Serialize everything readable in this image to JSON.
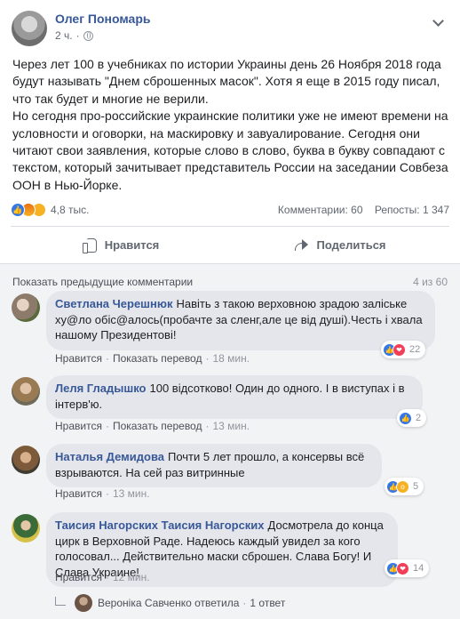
{
  "post": {
    "author": "Олег Пономарь",
    "time": "2 ч.",
    "paragraphs": [
      "Через лет 100 в учебниках по истории Украины день 26 Ноября 2018 года будут называть \"Днем сброшенных масок\". Хотя я еще в 2015 году писал, что так будет и многие не верили.",
      "Но сегодня про-российские украинские политики уже не имеют времени на условности и оговорки, на маскировку и завуалирование. Сегодня они читают свои заявления, которые слово в слово, буква в букву совпадают с текстом, который зачитывает представитель России на заседании Совбеза ООН в Нью-Йорке."
    ],
    "reactions_count": "4,8 тыс.",
    "comments_count": "Комментарии: 60",
    "shares_count": "Репосты: 1 347",
    "like_label": "Нравится",
    "share_label": "Поделиться"
  },
  "comments_header": {
    "show_previous": "Показать предыдущие комментарии",
    "pager": "4 из 60"
  },
  "comments": [
    {
      "name": "Светлана Черешнюк",
      "text": "Навіть з такою верховною зрадою заліське ху@ло обіс@алось(пробачте за сленг,але це від душі).Честь і хвала нашому Президентові!",
      "like": "Нравится",
      "translate": "Показать перевод",
      "time": "18 мин.",
      "reactions": "22",
      "reaction_icons": [
        "like-icon",
        "love-icon"
      ]
    },
    {
      "name": "Леля Гладышко",
      "text": "100 відсотково! Один до одного. І в виступах і в інтерв'ю.",
      "like": "Нравится",
      "translate": "Показать перевод",
      "time": "13 мин.",
      "reactions": "2",
      "reaction_icons": [
        "like-icon"
      ]
    },
    {
      "name": "Наталья Демидова",
      "text": "Почти 5 лет прошло, а консервы всё взрываются. На сей раз витринные",
      "like": "Нравится",
      "time": "13 мин.",
      "reactions": "5",
      "reaction_icons": [
        "like-icon",
        "wow-icon"
      ]
    },
    {
      "name": "Таисия Нагорских Таисия Нагорских",
      "text": "Досмотрела до конца цирк в Верховной Раде. Надеюсь каждый увидел за кого голосовал... Действительно маски сброшен. Слава Богу! И Слава Украине!",
      "like": "Нравится",
      "time": "12 мин.",
      "reactions": "14",
      "reaction_icons": [
        "like-icon",
        "love-icon"
      ]
    }
  ],
  "reply": {
    "text": "Вероніка Савченко ответила",
    "count": "1 ответ"
  },
  "colors": {
    "link": "#385898",
    "like": "#3578e5",
    "love": "#f33e58",
    "bubble": "#e4e6eb",
    "comments_bg": "#f2f3f5"
  }
}
